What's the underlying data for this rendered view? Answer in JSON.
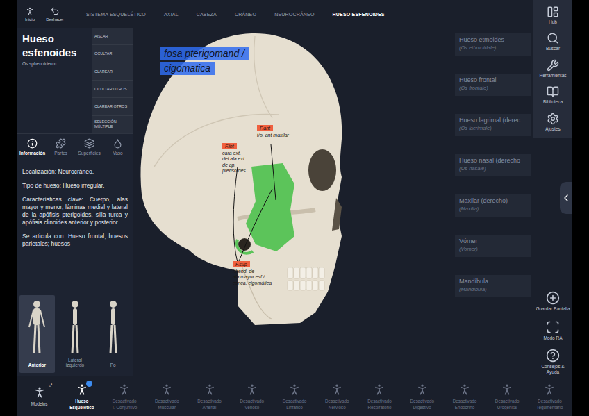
{
  "topbar": {
    "home": "Inicio",
    "undo": "Deshacer"
  },
  "breadcrumbs": [
    {
      "label": "SISTEMA ESQUELÉTICO",
      "selected": false
    },
    {
      "label": "AXIAL",
      "selected": false
    },
    {
      "label": "CABEZA",
      "selected": false
    },
    {
      "label": "CRÁNEO",
      "selected": false
    },
    {
      "label": "NEUROCRÁNEO",
      "selected": false
    },
    {
      "label": "HUESO ESFENOIDES",
      "selected": true
    }
  ],
  "structure": {
    "name": "Hueso esfenoides",
    "latin": "Os sphenoideum"
  },
  "actions": [
    "AISLAR",
    "OCULTAR",
    "CLAREAR",
    "OCULTAR OTROS",
    "CLAREAR OTROS",
    "SELECCIÓN MÚLTIPLE"
  ],
  "info_tabs": [
    {
      "label": "Información",
      "selected": true
    },
    {
      "label": "Partes",
      "selected": false
    },
    {
      "label": "Superficies",
      "selected": false
    },
    {
      "label": "Vaso",
      "selected": false
    }
  ],
  "info": [
    "Localización: Neurocráneo.",
    "Tipo de hueso: Hueso irregular.",
    "Características clave: Cuerpo, alas mayor y menor, láminas medial y lateral de la apófisis pterigoides, silla turca y apófisis clinoides anterior y posterior.",
    "Se articula con: Hueso frontal, huesos parietales; huesos"
  ],
  "views": [
    {
      "label": "Anterior",
      "selected": true
    },
    {
      "label": "Lateral izquierdo",
      "selected": false
    },
    {
      "label": "Po",
      "selected": false
    }
  ],
  "annotations": {
    "title": [
      "fosa pterigomand /",
      "cigomatica"
    ],
    "notes": [
      {
        "tag": "F.ant",
        "text": [
          "t/o. ant maxilar"
        ]
      },
      {
        "tag": "F.int",
        "text": [
          "cara ext.",
          "del ala ext.",
          "de ap.",
          "pterisoides"
        ]
      },
      {
        "tag": "F.sup",
        "text": [
          "f.hend. de",
          "ala mayor esf /",
          "conca. cigomática"
        ]
      }
    ]
  },
  "related": [
    {
      "name": "Hueso etmoides",
      "latin": "(Os ethmoidale)"
    },
    {
      "name": "Hueso frontal",
      "latin": "(Os frontale)"
    },
    {
      "name": "Hueso lagrimal (derec",
      "latin": "(Os lacrimale)"
    },
    {
      "name": "Hueso nasal (derecho",
      "latin": "(Os nasale)"
    },
    {
      "name": "Maxilar (derecho)",
      "latin": "(Maxilla)"
    },
    {
      "name": "Vómer",
      "latin": "(Vomer)"
    },
    {
      "name": "Mandíbula",
      "latin": "(Mandibula)"
    }
  ],
  "toolbar": [
    "Hub",
    "Buscar",
    "Herramientas",
    "Biblioteca",
    "Ajustes"
  ],
  "side_tools": [
    "Guardar Pantalla",
    "Modo RA",
    "Consejos & Ayuda"
  ],
  "gender": "♂",
  "systems": [
    {
      "lines": [
        "Modelos"
      ],
      "selected": false,
      "disabled": false
    },
    {
      "lines": [
        "Hueso",
        "Esquelético"
      ],
      "selected": true,
      "disabled": false
    },
    {
      "lines": [
        "Desactivado",
        "T. Conjuntivo"
      ],
      "selected": false,
      "disabled": true
    },
    {
      "lines": [
        "Desactivado",
        "Muscular"
      ],
      "selected": false,
      "disabled": true
    },
    {
      "lines": [
        "Desactivado",
        "Arterial"
      ],
      "selected": false,
      "disabled": true
    },
    {
      "lines": [
        "Desactivado",
        "Venoso"
      ],
      "selected": false,
      "disabled": true
    },
    {
      "lines": [
        "Desactivado",
        "Linfático"
      ],
      "selected": false,
      "disabled": true
    },
    {
      "lines": [
        "Desactivado",
        "Nervioso"
      ],
      "selected": false,
      "disabled": true
    },
    {
      "lines": [
        "Desactivado",
        "Respiratorio"
      ],
      "selected": false,
      "disabled": true
    },
    {
      "lines": [
        "Desactivado",
        "Digestivo"
      ],
      "selected": false,
      "disabled": true
    },
    {
      "lines": [
        "Desactivado",
        "Endocrino"
      ],
      "selected": false,
      "disabled": true
    },
    {
      "lines": [
        "Desactivado",
        "Urogenital"
      ],
      "selected": false,
      "disabled": true
    },
    {
      "lines": [
        "Desactivado",
        "Tegumentario"
      ],
      "selected": false,
      "disabled": true
    }
  ]
}
